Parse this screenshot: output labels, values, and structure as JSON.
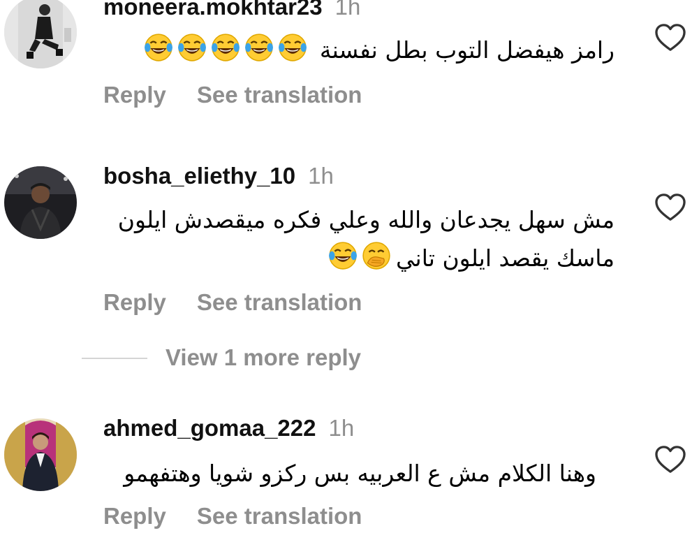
{
  "comments": [
    {
      "username": "moneera.mokhtar23",
      "time": "1h",
      "text": "رامز هيفضل التوب بطل نفسنة",
      "emojis": [
        "tears-of-joy-emoji",
        "tears-of-joy-emoji",
        "tears-of-joy-emoji",
        "tears-of-joy-emoji",
        "tears-of-joy-emoji"
      ],
      "reply_label": "Reply",
      "translate_label": "See translation"
    },
    {
      "username": "bosha_eliethy_10",
      "time": "1h",
      "text_line1": "مش سهل يجدعان والله وعلي فكره ميقصدش ايلون",
      "text_line2": "ماسك يقصد ايلون تاني",
      "emojis": [
        "hand-over-mouth-emoji",
        "tears-of-joy-emoji"
      ],
      "reply_label": "Reply",
      "translate_label": "See translation"
    },
    {
      "username": "ahmed_gomaa_222",
      "time": "1h",
      "text": "وهنا الكلام مش ع العربيه بس ركزو شويا وهتفهمو",
      "reply_label": "Reply",
      "translate_label": "See translation"
    }
  ],
  "view_more_replies": "View 1 more reply",
  "icons": {
    "like": "heart-outline-icon"
  },
  "colors": {
    "muted": "#8e8e8e",
    "text": "#000000"
  }
}
